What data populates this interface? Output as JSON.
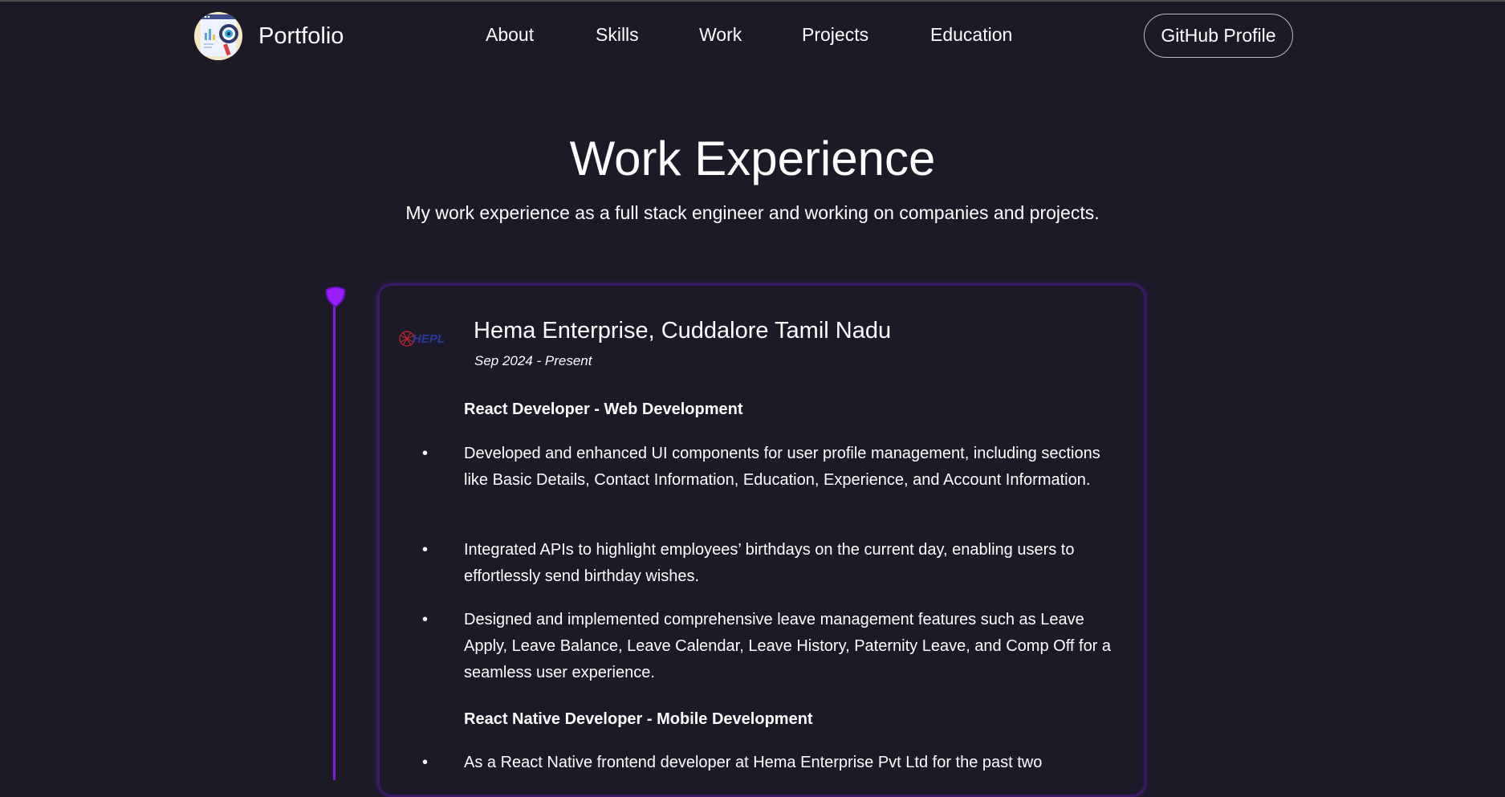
{
  "navbar": {
    "brand_name": "Portfolio",
    "links": [
      "About",
      "Skills",
      "Work",
      "Projects",
      "Education"
    ],
    "github_label": "GitHub Profile"
  },
  "section": {
    "title": "Work Experience",
    "subtitle": "My work experience as a full stack engineer and working on companies and projects."
  },
  "experience": {
    "company": "Hema Enterprise, Cuddalore Tamil Nadu",
    "logo_text": "HEPL",
    "dates": "Sep 2024 - Present",
    "roles": [
      {
        "title": "React Developer - Web Development",
        "bullets": [
          "Developed and enhanced UI components for user profile management, including sections like Basic Details, Contact Information, Education, Experience, and Account Information.",
          "Integrated APIs to highlight employees’ birthdays on the current day, enabling users to effortlessly send birthday wishes.",
          "Designed and implemented comprehensive leave management features such as Leave Apply, Leave Balance, Leave Calendar, Leave History, Paternity Leave, and Comp Off for a seamless user experience."
        ]
      },
      {
        "title": "React Native Developer - Mobile Development",
        "bullets": [
          "As a React Native frontend developer at Hema Enterprise Pvt Ltd for the past two"
        ]
      }
    ]
  },
  "colors": {
    "background": "#1c1a27",
    "accent": "#7b1fd8",
    "dot": "#9b1dff",
    "card_border": "#3a1a66"
  }
}
